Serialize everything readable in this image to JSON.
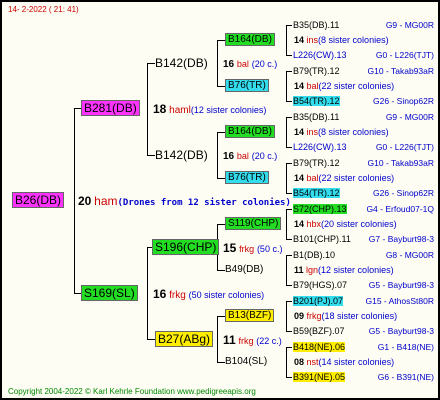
{
  "header": {
    "date": "14- 2-2022 ( 21: 41)"
  },
  "footer": {
    "copyright": "Copyright 2004-2022 © Karl Kehrle Foundation   www.pedigreeapis.org"
  },
  "root": {
    "id": "B26(DB)",
    "count": "20",
    "race": "ham",
    "note": "(Drones from 12 sister colonies)"
  },
  "gen1": [
    {
      "id": "B281(DB)",
      "count": "18",
      "race": "haml",
      "note": "(12 sister colonies)"
    },
    {
      "id": "S169(SL)",
      "count": "16",
      "race": "frkg",
      "note": "(50 sister colonies)"
    }
  ],
  "gen2": [
    {
      "id": "B142(DB)"
    },
    {
      "id": "B142(DB)"
    },
    {
      "id": "S196(CHP)",
      "count": "15",
      "race": "frkg",
      "note": "(50 c.)"
    },
    {
      "id": "B27(ABg)",
      "count": "11",
      "race": "frkg",
      "note": "(22 c.)"
    }
  ],
  "gen3": [
    {
      "id": "B164(DB)",
      "count": "16",
      "race": "bal",
      "note": "(20 c.)"
    },
    {
      "id": "B76(TR)"
    },
    {
      "id": "B164(DB)",
      "count": "16",
      "race": "bal",
      "note": "(20 c.)"
    },
    {
      "id": "B76(TR)"
    },
    {
      "id": "S119(CHP)",
      "count": "14",
      "race": "hbx",
      "note": "(20 sister colonies)"
    },
    {
      "id": "B49(DB)",
      "count": "11",
      "race": "lgn",
      "note": "(12 sister colonies)"
    },
    {
      "id": "B13(BZF)",
      "count": "09",
      "race": "frkg",
      "note": "(18 sister colonies)"
    },
    {
      "id": "B104(SL)",
      "count": "08",
      "race": "nst",
      "note": "(14 sister colonies)"
    }
  ],
  "gen4": [
    {
      "id": "B35(DB).11",
      "right": "G9 - MG00R"
    },
    {
      "id": "L226(CW).13",
      "right": "G0 - L226(TJT)"
    },
    {
      "id": "B79(TR).12",
      "right": "G10 - Takab93aR"
    },
    {
      "id": "B54(TR).12",
      "right": "G26 - Sinop62R"
    },
    {
      "id": "B35(DB).11",
      "right": "G9 - MG00R"
    },
    {
      "id": "L226(CW).13",
      "right": "G0 - L226(TJT)"
    },
    {
      "id": "B79(TR).12",
      "right": "G10 - Takab93aR"
    },
    {
      "id": "B54(TR).12",
      "right": "G26 - Sinop62R"
    },
    {
      "id": "S72(CHP).13",
      "right": "G4 - Erfoud07-1Q"
    },
    {
      "id": "B101(CHP).11",
      "right": "G7 - Bayburt98-3"
    },
    {
      "id": "B1(DB).10",
      "right": "G8 - MG00R"
    },
    {
      "id": "B79(HGS).07",
      "right": "G5 - Bayburt98-3"
    },
    {
      "id": "B201(PJ).07",
      "right": "G15 - AthosSt80R"
    },
    {
      "id": "B59(BZF).07",
      "right": "G5 - Bayburt98-3"
    },
    {
      "id": "B418(NE).06",
      "right": "G1 - B418(NE)"
    },
    {
      "id": "B391(NE).05",
      "right": "G6 - B391(NE)"
    }
  ],
  "gen4notes": [
    {
      "count": "14",
      "race": "ins",
      "note": "(8 sister colonies)"
    },
    {
      "count": "14",
      "race": "bal",
      "note": "(22 sister colonies)"
    },
    {
      "count": "14",
      "race": "ins",
      "note": "(8 sister colonies)"
    },
    {
      "count": "14",
      "race": "bal",
      "note": "(22 sister colonies)"
    },
    {
      "count": "14",
      "race": "hbx",
      "note": "(20 sister colonies)"
    },
    {
      "count": "11",
      "race": "lgn",
      "note": "(12 sister colonies)"
    },
    {
      "count": "09",
      "race": "frkg",
      "note": "(18 sister colonies)"
    },
    {
      "count": "08",
      "race": "nst",
      "note": "(14 sister colonies)"
    }
  ],
  "colors": {
    "magenta": "#ff33ff",
    "green": "#22dd22",
    "cyan": "#33ddee",
    "yellow": "#ffee00",
    "red": "#cc0000",
    "blue": "#0000cc",
    "footer": "#008800"
  }
}
